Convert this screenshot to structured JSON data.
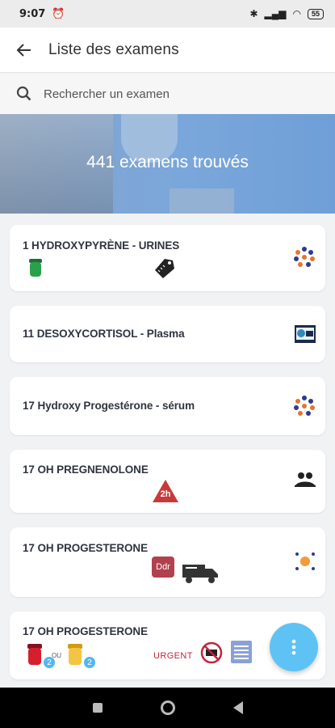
{
  "status": {
    "time": "9:07",
    "alarm_icon": "alarm-icon",
    "battery": "55"
  },
  "header": {
    "title": "Liste des examens"
  },
  "search": {
    "placeholder": "Rechercher un examen"
  },
  "banner": {
    "count_text": "441 examens trouvés"
  },
  "exams": [
    {
      "name": "1 HYDROXYPYRÈNE - URINES",
      "icons": [
        "green-tube-icon",
        "price-tag-icon"
      ],
      "right_icon": "molecule-dots-icon"
    },
    {
      "name": "11 DESOXYCORTISOL - Plasma",
      "icons": [],
      "right_icon": "id-card-icon"
    },
    {
      "name": "17 Hydroxy Progestérone - sérum",
      "icons": [],
      "right_icon": "molecule-dots-icon"
    },
    {
      "name": "17 OH PREGNENOLONE",
      "icons": [
        "warning-2h-icon"
      ],
      "warning_label": "2h",
      "right_icon": "patient-bed-icon"
    },
    {
      "name": "17 OH PROGESTERONE",
      "icons": [
        "ddr-badge-icon",
        "delivery-truck-icon"
      ],
      "ddr_label": "Ddr",
      "right_icon": "cell-icon"
    },
    {
      "name": "17 OH PROGESTERONE",
      "icons": [
        "red-tube-icon",
        "yellow-tube-icon",
        "no-icon",
        "document-icon"
      ],
      "tube_count_1": "2",
      "tube_count_2": "2",
      "ou_label": "OU",
      "urgent_label": "URGENT"
    }
  ],
  "fab": {
    "icon": "more-vertical-icon"
  },
  "colors": {
    "accent": "#5ec3f4",
    "urgent": "#c0253a",
    "banner": "#7aa7db"
  }
}
